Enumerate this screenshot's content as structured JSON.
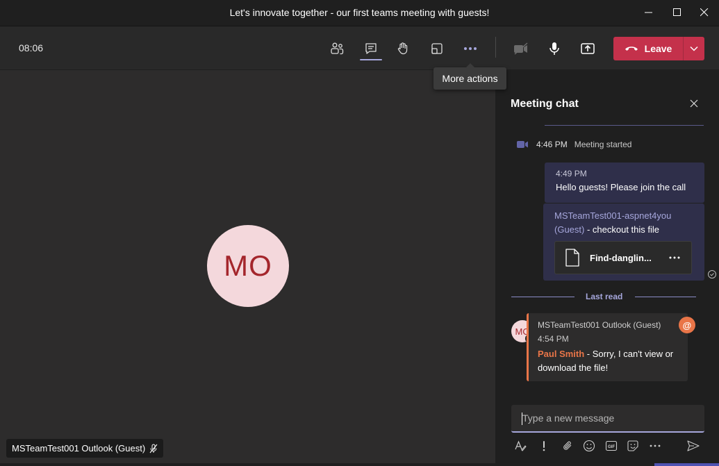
{
  "window": {
    "title": "Let's innovate together - our first teams meeting with guests!",
    "minimize_icon": "minimize-icon",
    "maximize_icon": "maximize-icon",
    "close_icon": "close-icon"
  },
  "toolbar": {
    "timer": "08:06",
    "buttons": [
      "people-icon",
      "chat-icon",
      "raise-hand-icon",
      "share-tray-icon",
      "more-actions-icon",
      "camera-off-icon",
      "microphone-icon",
      "share-screen-icon"
    ],
    "leave_label": "Leave",
    "tooltip": "More actions"
  },
  "stage": {
    "avatar_initials": "MO",
    "participant_name": "MSTeamTest001 Outlook (Guest)"
  },
  "chat": {
    "title": "Meeting chat",
    "system_message": {
      "time": "4:46 PM",
      "text": "Meeting started"
    },
    "my_message": {
      "time": "4:49 PM",
      "text": "Hello guests! Please join the call"
    },
    "my_message_2": {
      "mention": "MSTeamTest001-aspnet4you (Guest)",
      "text": " - checkout this file",
      "file_name": "Find-danglin..."
    },
    "last_read_label": "Last read",
    "incoming": {
      "avatar_initials": "MO",
      "sender": "MSTeamTest001 Outlook (Guest)",
      "time": "4:54 PM",
      "mentioned_user": "Paul Smith",
      "text": " - Sorry, I can't view or download the file!",
      "badge": "@"
    },
    "compose_placeholder": "Type a new message"
  },
  "colors": {
    "accent": "#a6a7dc",
    "leave": "#c4314b",
    "mention": "#e97548",
    "avatar_bg": "#f4d8dc",
    "avatar_fg": "#a4262c"
  }
}
